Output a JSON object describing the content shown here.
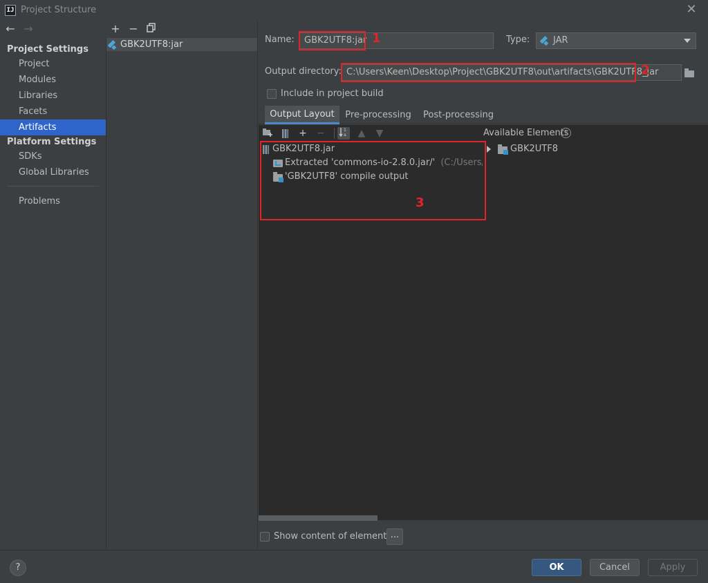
{
  "window": {
    "title": "Project Structure",
    "app_icon": "IJ"
  },
  "sidebar": {
    "project_settings_header": "Project Settings",
    "project_items": [
      {
        "label": "Project"
      },
      {
        "label": "Modules"
      },
      {
        "label": "Libraries"
      },
      {
        "label": "Facets"
      },
      {
        "label": "Artifacts",
        "selected": true
      }
    ],
    "platform_settings_header": "Platform Settings",
    "platform_items": [
      {
        "label": "SDKs"
      },
      {
        "label": "Global Libraries"
      }
    ],
    "problems": "Problems"
  },
  "artifact_list": {
    "toolbar": {
      "add": "+",
      "remove": "−"
    },
    "items": [
      {
        "label": "GBK2UTF8:jar"
      }
    ]
  },
  "form": {
    "name_label": "Name:",
    "name_value": "GBK2UTF8:jar",
    "type_label": "Type:",
    "type_value": "JAR",
    "output_dir_label": "Output directory:",
    "output_dir_value": "C:\\Users\\Keen\\Desktop\\Project\\GBK2UTF8\\out\\artifacts\\GBK2UTF8_jar",
    "include_build_label": "Include in project build",
    "include_build_checked": false
  },
  "annotations": {
    "n1": "1",
    "n2": "2",
    "n3": "3",
    "color": "#e0242a"
  },
  "tabs": [
    {
      "label": "Output Layout",
      "active": true
    },
    {
      "label": "Pre-processing"
    },
    {
      "label": "Post-processing"
    }
  ],
  "layout_tree": {
    "root": "GBK2UTF8.jar",
    "children": [
      {
        "label": "Extracted 'commons-io-2.8.0.jar/'",
        "detail": "(C:/Users/Keen/"
      },
      {
        "label": "'GBK2UTF8' compile output"
      }
    ]
  },
  "available": {
    "label": "Available Elements",
    "items": [
      {
        "label": "GBK2UTF8"
      }
    ]
  },
  "footer": {
    "show_content_label": "Show content of elements",
    "dots": "...",
    "help": "?",
    "ok": "OK",
    "cancel": "Cancel",
    "apply": "Apply"
  },
  "colors": {
    "selection": "#2f65ca",
    "primary_button": "#365880",
    "jar_icon": "#4aa6d9"
  }
}
